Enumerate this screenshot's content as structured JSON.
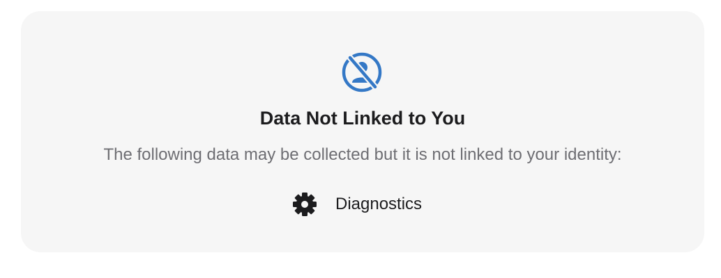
{
  "privacy_card": {
    "title": "Data Not Linked to You",
    "description": "The following data may be collected but it is not linked to your identity:",
    "hero_icon": "person-crossed-out-icon",
    "accent_color": "#3478c6",
    "items": [
      {
        "icon": "gear-icon",
        "label": "Diagnostics"
      }
    ]
  }
}
